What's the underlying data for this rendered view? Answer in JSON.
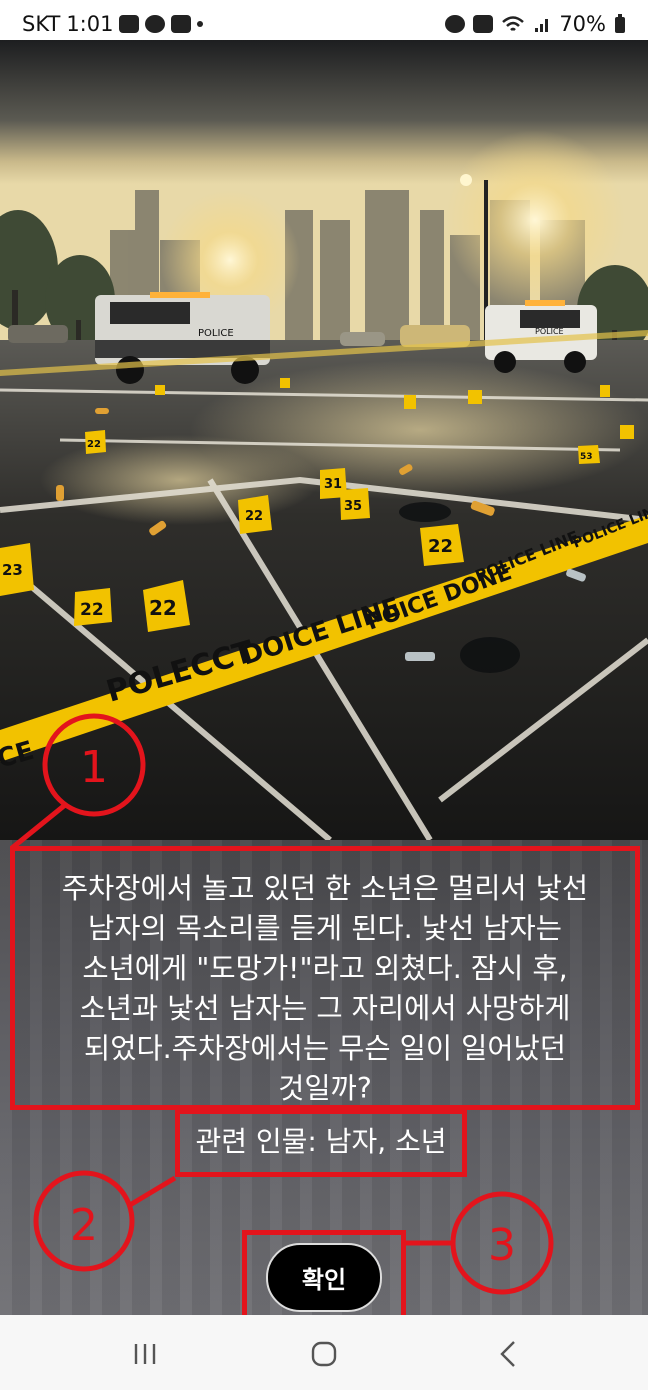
{
  "status_bar": {
    "carrier": "SKT",
    "time": "1:01",
    "battery": "70%",
    "icons": [
      "gallery-icon",
      "talk-icon",
      "youtube-icon",
      "alarm-icon",
      "mute-icon",
      "wifi-icon",
      "signal-icon",
      "battery-icon"
    ]
  },
  "scene": {
    "tape_texts": [
      "POLECCT",
      "DOICE LINE",
      "POICE DONE",
      "POLICE LINE",
      "POLICE LINE",
      "CE"
    ],
    "vehicle_labels": [
      "POLICE",
      "POLICE"
    ],
    "marker_numbers": [
      "22",
      "22",
      "22",
      "23",
      "31",
      "35",
      "22",
      "53",
      "22"
    ]
  },
  "story": {
    "line1": "주차장에서 놀고 있던 한 소년은 멀리서 낯선",
    "line2": "남자의 목소리를 듣게 된다. 낯선 남자는",
    "line3": "소년에게 \"도망가!\"라고 외쳤다. 잠시 후,",
    "line4": "소년과 낯선 남자는 그 자리에서 사망하게",
    "line5": "되었다.주차장에서는 무슨 일이 일어났던",
    "line6": "것일까?"
  },
  "people": {
    "text": "관련 인물: 남자, 소년"
  },
  "confirm": {
    "label": "확인"
  },
  "annotations": {
    "num1": "1",
    "num2": "2",
    "num3": "3"
  },
  "colors": {
    "annotation_red": "#e3141c",
    "button_bg": "#000000",
    "tape_yellow": "#f2c200"
  }
}
